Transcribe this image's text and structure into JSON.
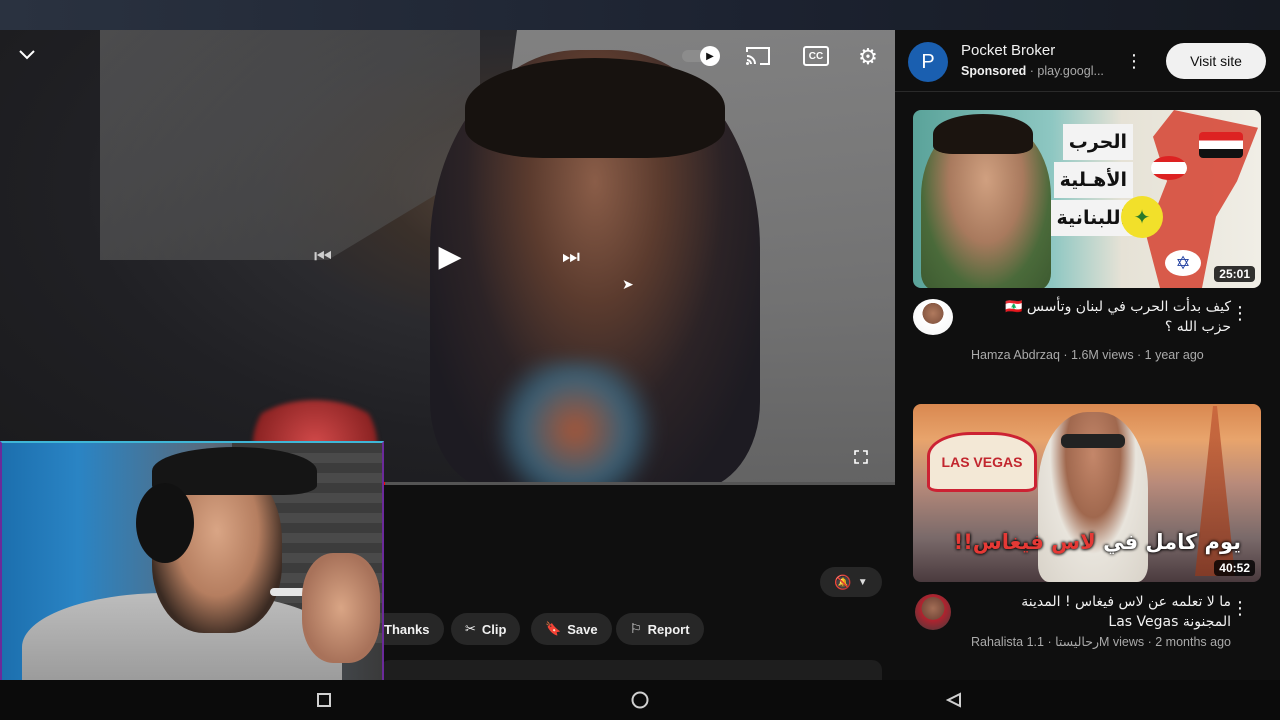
{
  "video": {
    "progress_fraction": 0.43,
    "controls": {
      "collapse_icon": "chevron-down-icon",
      "autoplay_icon": "autoplay-toggle-icon",
      "cast_icon": "cast-icon",
      "captions_label": "CC",
      "settings_icon": "gear-icon",
      "prev_icon": "skip-previous-icon",
      "play_icon": "play-icon",
      "next_icon": "skip-next-icon",
      "fullscreen_icon": "fullscreen-icon"
    }
  },
  "actions": {
    "thanks_label": "Thanks",
    "clip_label": "Clip",
    "save_label": "Save",
    "report_label": "Report",
    "notify_icon": "bell-off-icon"
  },
  "ad": {
    "logo_letter": "P",
    "name": "Pocket Broker",
    "sponsored": "Sponsored",
    "domain": "play.googl...",
    "cta": "Visit site",
    "brand_color": "#1a5fb0"
  },
  "recommendations": [
    {
      "thumb_text": [
        "الحرب",
        "الأهـلية",
        "اللبنانية"
      ],
      "duration": "25:01",
      "title": "كيف بدأت الحرب في لبنان وتأسس 🇱🇧 حزب الله ؟",
      "channel": "Hamza Abdrzaq",
      "meta": "1.6M views · 1 year ago"
    },
    {
      "thumb_sign": "LAS VEGAS",
      "thumb_caption_white": "يوم كامل في",
      "thumb_caption_red": "لاس فيغاس!!",
      "duration": "40:52",
      "title": "ما لا تعلمه عن لاس فيغاس ! المدينة المجنونة Las Vegas",
      "channel": "Rahalista رحاليستا",
      "meta": "1.1M views · 2 months ago"
    }
  ],
  "nav": {
    "back_icon": "back-triangle-icon",
    "home_icon": "home-circle-icon",
    "recents_icon": "recents-square-icon"
  }
}
